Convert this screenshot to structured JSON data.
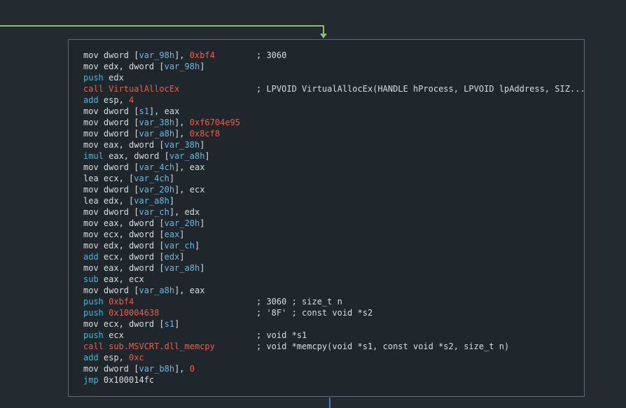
{
  "palette": {
    "background": "#232b30",
    "node_background": "#1f272c",
    "node_border": "#5e6a72",
    "text": "#d8dde0",
    "mnemonic_flow": "#4fb3d1",
    "immediate": "#e0614f",
    "variable": "#6fb7d8",
    "edge_incoming": "#8fbf6e",
    "edge_outgoing": "#3f7fbf"
  },
  "lines": [
    {
      "tokens": [
        {
          "t": "mov dword ",
          "c": "w"
        },
        {
          "t": "[",
          "c": "bk"
        },
        {
          "t": "var_98h",
          "c": "b"
        },
        {
          "t": "]",
          "c": "bk"
        },
        {
          "t": ", ",
          "c": "w"
        },
        {
          "t": "0xbf4",
          "c": "r"
        }
      ],
      "comment": "; 3060"
    },
    {
      "tokens": [
        {
          "t": "mov edx, dword ",
          "c": "w"
        },
        {
          "t": "[",
          "c": "bk"
        },
        {
          "t": "var_98h",
          "c": "b"
        },
        {
          "t": "]",
          "c": "bk"
        }
      ],
      "comment": ""
    },
    {
      "tokens": [
        {
          "t": "push",
          "c": "c"
        },
        {
          "t": " edx",
          "c": "w"
        }
      ],
      "comment": ""
    },
    {
      "tokens": [
        {
          "t": "call VirtualAllocEx",
          "c": "r"
        }
      ],
      "comment": "; LPVOID VirtualAllocEx(HANDLE hProcess, LPVOID lpAddress, SIZ..."
    },
    {
      "tokens": [
        {
          "t": "add",
          "c": "c"
        },
        {
          "t": " esp, ",
          "c": "w"
        },
        {
          "t": "4",
          "c": "r"
        }
      ],
      "comment": ""
    },
    {
      "tokens": [
        {
          "t": "mov dword ",
          "c": "w"
        },
        {
          "t": "[",
          "c": "bk"
        },
        {
          "t": "s1",
          "c": "b"
        },
        {
          "t": "]",
          "c": "bk"
        },
        {
          "t": ", eax",
          "c": "w"
        }
      ],
      "comment": ""
    },
    {
      "tokens": [
        {
          "t": "mov dword ",
          "c": "w"
        },
        {
          "t": "[",
          "c": "bk"
        },
        {
          "t": "var_38h",
          "c": "b"
        },
        {
          "t": "]",
          "c": "bk"
        },
        {
          "t": ", ",
          "c": "w"
        },
        {
          "t": "0xf6704e95",
          "c": "r"
        }
      ],
      "comment": ""
    },
    {
      "tokens": [
        {
          "t": "mov dword ",
          "c": "w"
        },
        {
          "t": "[",
          "c": "bk"
        },
        {
          "t": "var_a8h",
          "c": "b"
        },
        {
          "t": "]",
          "c": "bk"
        },
        {
          "t": ", ",
          "c": "w"
        },
        {
          "t": "0x8cf8",
          "c": "r"
        }
      ],
      "comment": ""
    },
    {
      "tokens": [
        {
          "t": "mov eax, dword ",
          "c": "w"
        },
        {
          "t": "[",
          "c": "bk"
        },
        {
          "t": "var_38h",
          "c": "b"
        },
        {
          "t": "]",
          "c": "bk"
        }
      ],
      "comment": ""
    },
    {
      "tokens": [
        {
          "t": "imul",
          "c": "c"
        },
        {
          "t": " eax, dword ",
          "c": "w"
        },
        {
          "t": "[",
          "c": "bk"
        },
        {
          "t": "var_a8h",
          "c": "b"
        },
        {
          "t": "]",
          "c": "bk"
        }
      ],
      "comment": ""
    },
    {
      "tokens": [
        {
          "t": "mov dword ",
          "c": "w"
        },
        {
          "t": "[",
          "c": "bk"
        },
        {
          "t": "var_4ch",
          "c": "b"
        },
        {
          "t": "]",
          "c": "bk"
        },
        {
          "t": ", eax",
          "c": "w"
        }
      ],
      "comment": ""
    },
    {
      "tokens": [
        {
          "t": "lea ecx, ",
          "c": "w"
        },
        {
          "t": "[",
          "c": "bk"
        },
        {
          "t": "var_4ch",
          "c": "b"
        },
        {
          "t": "]",
          "c": "bk"
        }
      ],
      "comment": ""
    },
    {
      "tokens": [
        {
          "t": "mov dword ",
          "c": "w"
        },
        {
          "t": "[",
          "c": "bk"
        },
        {
          "t": "var_20h",
          "c": "b"
        },
        {
          "t": "]",
          "c": "bk"
        },
        {
          "t": ", ecx",
          "c": "w"
        }
      ],
      "comment": ""
    },
    {
      "tokens": [
        {
          "t": "lea edx, ",
          "c": "w"
        },
        {
          "t": "[",
          "c": "bk"
        },
        {
          "t": "var_a8h",
          "c": "b"
        },
        {
          "t": "]",
          "c": "bk"
        }
      ],
      "comment": ""
    },
    {
      "tokens": [
        {
          "t": "mov dword ",
          "c": "w"
        },
        {
          "t": "[",
          "c": "bk"
        },
        {
          "t": "var_ch",
          "c": "b"
        },
        {
          "t": "]",
          "c": "bk"
        },
        {
          "t": ", edx",
          "c": "w"
        }
      ],
      "comment": ""
    },
    {
      "tokens": [
        {
          "t": "mov eax, dword ",
          "c": "w"
        },
        {
          "t": "[",
          "c": "bk"
        },
        {
          "t": "var_20h",
          "c": "b"
        },
        {
          "t": "]",
          "c": "bk"
        }
      ],
      "comment": ""
    },
    {
      "tokens": [
        {
          "t": "mov ecx, dword ",
          "c": "w"
        },
        {
          "t": "[",
          "c": "bk"
        },
        {
          "t": "eax",
          "c": "b"
        },
        {
          "t": "]",
          "c": "bk"
        }
      ],
      "comment": ""
    },
    {
      "tokens": [
        {
          "t": "mov edx, dword ",
          "c": "w"
        },
        {
          "t": "[",
          "c": "bk"
        },
        {
          "t": "var_ch",
          "c": "b"
        },
        {
          "t": "]",
          "c": "bk"
        }
      ],
      "comment": ""
    },
    {
      "tokens": [
        {
          "t": "add",
          "c": "c"
        },
        {
          "t": " ecx, dword ",
          "c": "w"
        },
        {
          "t": "[",
          "c": "bk"
        },
        {
          "t": "edx",
          "c": "b"
        },
        {
          "t": "]",
          "c": "bk"
        }
      ],
      "comment": ""
    },
    {
      "tokens": [
        {
          "t": "mov eax, dword ",
          "c": "w"
        },
        {
          "t": "[",
          "c": "bk"
        },
        {
          "t": "var_a8h",
          "c": "b"
        },
        {
          "t": "]",
          "c": "bk"
        }
      ],
      "comment": ""
    },
    {
      "tokens": [
        {
          "t": "sub",
          "c": "c"
        },
        {
          "t": " eax, ecx",
          "c": "w"
        }
      ],
      "comment": ""
    },
    {
      "tokens": [
        {
          "t": "mov dword ",
          "c": "w"
        },
        {
          "t": "[",
          "c": "bk"
        },
        {
          "t": "var_a8h",
          "c": "b"
        },
        {
          "t": "]",
          "c": "bk"
        },
        {
          "t": ", eax",
          "c": "w"
        }
      ],
      "comment": ""
    },
    {
      "tokens": [
        {
          "t": "push",
          "c": "c"
        },
        {
          "t": " ",
          "c": "w"
        },
        {
          "t": "0xbf4",
          "c": "r"
        }
      ],
      "comment": "; 3060 ; size_t n"
    },
    {
      "tokens": [
        {
          "t": "push",
          "c": "c"
        },
        {
          "t": " ",
          "c": "w"
        },
        {
          "t": "0x10004638",
          "c": "r"
        }
      ],
      "comment": "; '8F' ; const void *s2"
    },
    {
      "tokens": [
        {
          "t": "mov ecx, dword ",
          "c": "w"
        },
        {
          "t": "[",
          "c": "bk"
        },
        {
          "t": "s1",
          "c": "b"
        },
        {
          "t": "]",
          "c": "bk"
        }
      ],
      "comment": ""
    },
    {
      "tokens": [
        {
          "t": "push",
          "c": "c"
        },
        {
          "t": " ecx",
          "c": "w"
        }
      ],
      "comment": "; void *s1"
    },
    {
      "tokens": [
        {
          "t": "call sub.MSVCRT.dll_memcpy",
          "c": "r"
        }
      ],
      "comment": "; void *memcpy(void *s1, const void *s2, size_t n)"
    },
    {
      "tokens": [
        {
          "t": "add",
          "c": "c"
        },
        {
          "t": " esp, ",
          "c": "w"
        },
        {
          "t": "0xc",
          "c": "r"
        }
      ],
      "comment": ""
    },
    {
      "tokens": [
        {
          "t": "mov dword ",
          "c": "w"
        },
        {
          "t": "[",
          "c": "bk"
        },
        {
          "t": "var_b8h",
          "c": "b"
        },
        {
          "t": "]",
          "c": "bk"
        },
        {
          "t": ", ",
          "c": "w"
        },
        {
          "t": "0",
          "c": "r"
        }
      ],
      "comment": ""
    },
    {
      "tokens": [
        {
          "t": "jmp",
          "c": "c"
        },
        {
          "t": " 0x100014fc",
          "c": "w"
        }
      ],
      "comment": ""
    }
  ]
}
